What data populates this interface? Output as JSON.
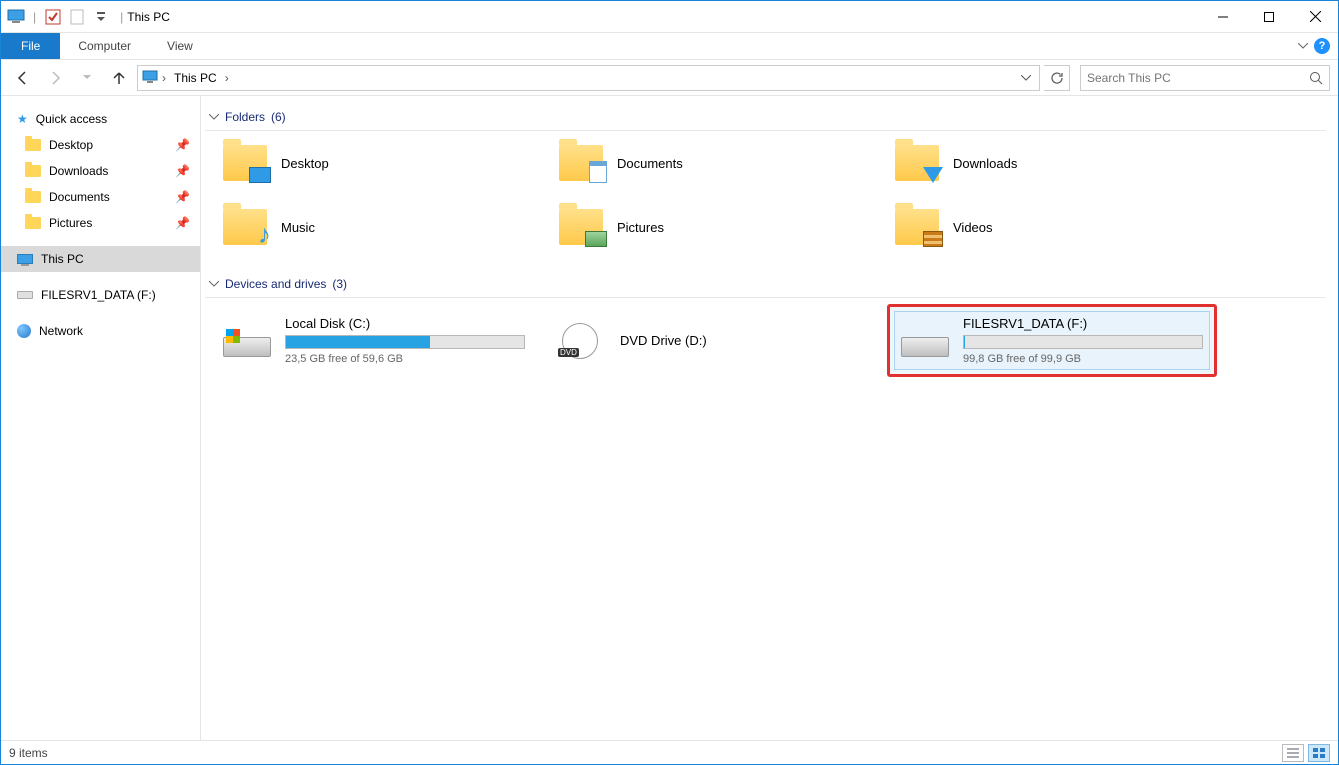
{
  "window": {
    "title": "This PC"
  },
  "ribbon": {
    "file": "File",
    "tabs": [
      "Computer",
      "View"
    ]
  },
  "breadcrumb": {
    "root": "This PC"
  },
  "search": {
    "placeholder": "Search This PC"
  },
  "sidebar": {
    "quick_access": "Quick access",
    "pinned": [
      "Desktop",
      "Downloads",
      "Documents",
      "Pictures"
    ],
    "this_pc": "This PC",
    "mapped_drive": "FILESRV1_DATA (F:)",
    "network": "Network"
  },
  "groups": {
    "folders": {
      "label": "Folders",
      "count": "(6)"
    },
    "drives": {
      "label": "Devices and drives",
      "count": "(3)"
    }
  },
  "folders": [
    {
      "name": "Desktop"
    },
    {
      "name": "Documents"
    },
    {
      "name": "Downloads"
    },
    {
      "name": "Music"
    },
    {
      "name": "Pictures"
    },
    {
      "name": "Videos"
    }
  ],
  "drives": [
    {
      "name": "Local Disk (C:)",
      "free_text": "23,5 GB free of 59,6 GB",
      "fill_pct": 60.6
    },
    {
      "name": "DVD Drive (D:)"
    },
    {
      "name": "FILESRV1_DATA (F:)",
      "free_text": "99,8 GB free of 99,9 GB",
      "fill_pct": 0.1
    }
  ],
  "status": {
    "text": "9 items"
  }
}
